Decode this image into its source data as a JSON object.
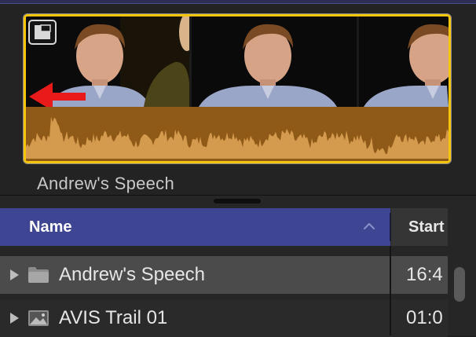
{
  "clip": {
    "title": "Andrew's Speech",
    "border_color": "#f5c50c",
    "audio_color": "#8f5a17",
    "wave_color": "#d49a4e"
  },
  "header": {
    "name_label": "Name",
    "start_label": "Start",
    "name_bg": "#3e4694"
  },
  "rows": [
    {
      "name": "Andrew's Speech",
      "start": "16:4",
      "icon": "folder-icon",
      "selected": true
    },
    {
      "name": "AVIS Trail 01",
      "start": "01:0",
      "icon": "image-icon",
      "selected": false
    }
  ],
  "icons": {
    "clip_badge": "clip-appearance-icon",
    "arrow": "red-left-arrow-icon",
    "sort": "chevron-up-icon",
    "disclosure": "disclosure-triangle-icon"
  }
}
